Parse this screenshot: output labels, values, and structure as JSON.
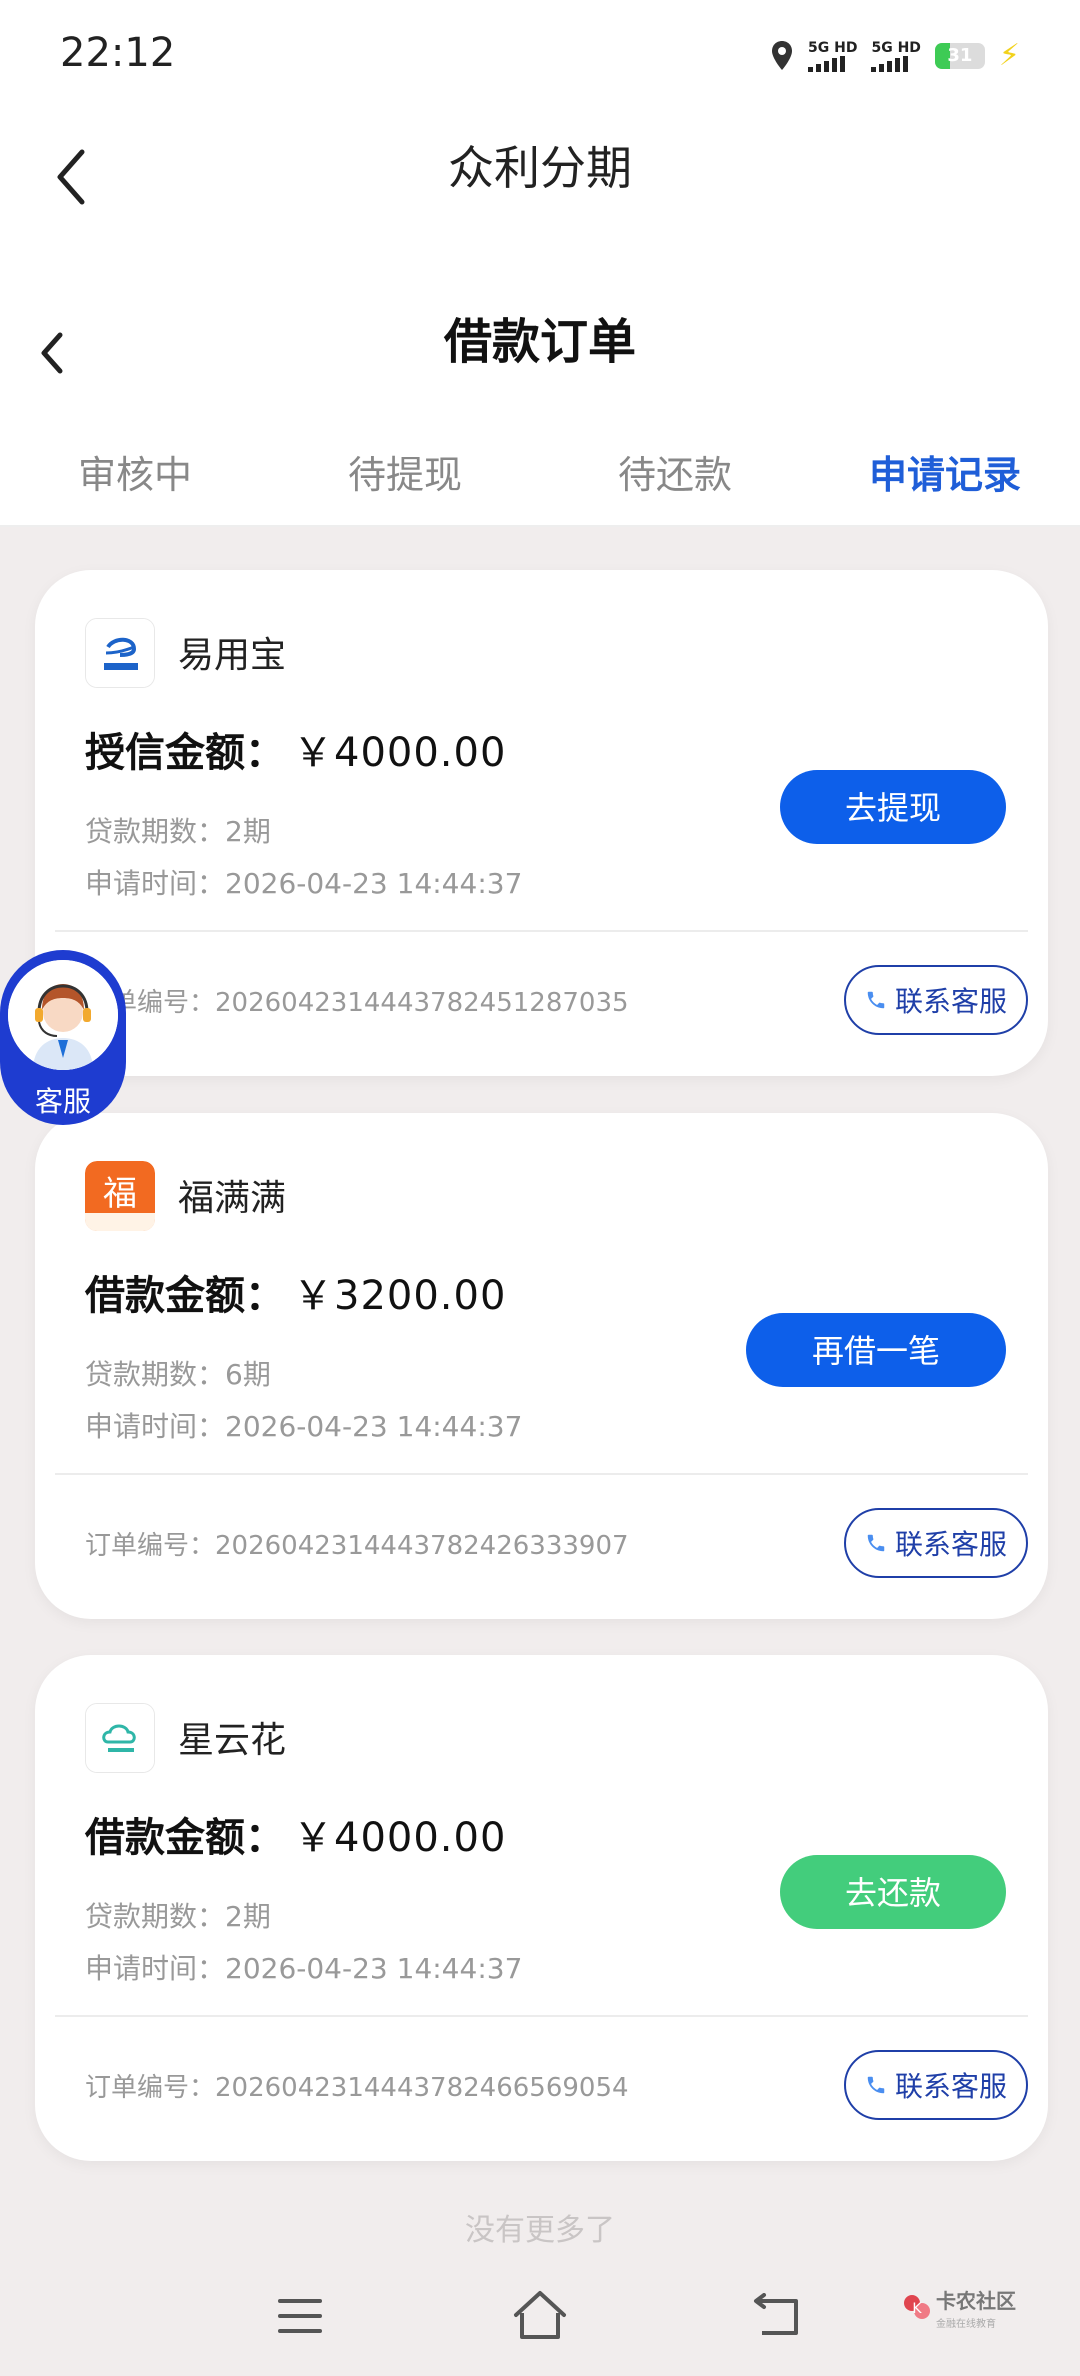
{
  "status": {
    "time": "22:12",
    "sim1": "5G HD",
    "sim2": "5G HD",
    "battery": "31",
    "battery_level": 0.31
  },
  "app": {
    "title": "众利分期"
  },
  "page": {
    "title": "借款订单"
  },
  "tabs": [
    {
      "label": "审核中",
      "active": false
    },
    {
      "label": "待提现",
      "active": false
    },
    {
      "label": "待还款",
      "active": false
    },
    {
      "label": "申请记录",
      "active": true
    }
  ],
  "orders": [
    {
      "name": "易用宝",
      "amount_label": "授信金额：",
      "amount": "￥4000.00",
      "periods": "贷款期数：2期",
      "time": "申请时间：2026-04-23 14:44:37",
      "button": "去提现",
      "button_color": "#0d5fea",
      "order_no": "订单编号：2026042314443782451287035",
      "contact": "联系客服",
      "logo_text": "易用宝"
    },
    {
      "name": "福满满",
      "amount_label": "借款金额：",
      "amount": "￥3200.00",
      "periods": "贷款期数：6期",
      "time": "申请时间：2026-04-23 14:44:37",
      "button": "再借一笔",
      "button_color": "#0d5fea",
      "order_no": "订单编号：2026042314443782426333907",
      "contact": "联系客服",
      "logo_text": "福满满"
    },
    {
      "name": "星云花",
      "amount_label": "借款金额：",
      "amount": "￥4000.00",
      "periods": "贷款期数：2期",
      "time": "申请时间：2026-04-23 14:44:37",
      "button": "去还款",
      "button_color": "#43cd7c",
      "order_no": "订单编号：2026042314443782466569054",
      "contact": "联系客服",
      "logo_text": "星云花"
    }
  ],
  "floating_service": {
    "label": "客服"
  },
  "footer": {
    "no_more": "没有更多了"
  },
  "watermark": {
    "main": "卡农社区",
    "sub": "金融在线教育"
  },
  "colors": {
    "accent": "#1f5ed8",
    "primary_button": "#0d5fea",
    "repay_button": "#43cd7c",
    "service_float": "#1e3cd0"
  }
}
